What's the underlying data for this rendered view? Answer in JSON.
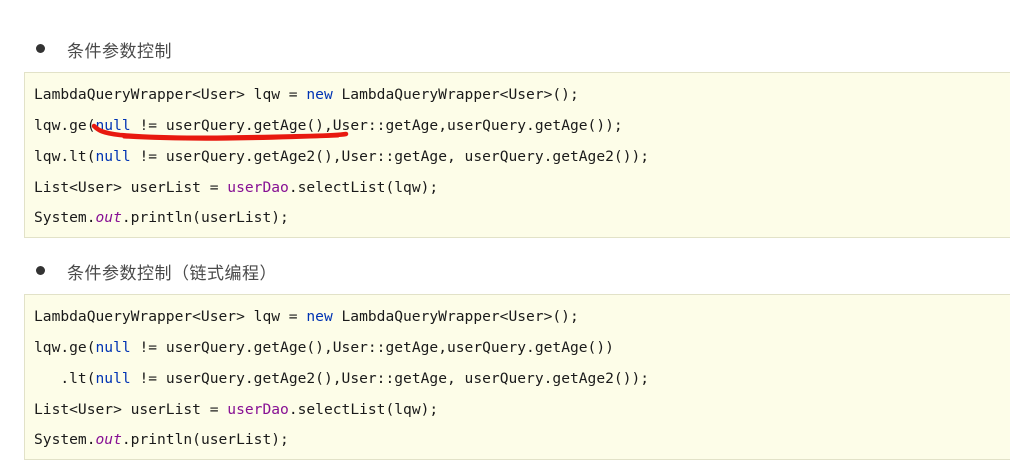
{
  "section1": {
    "heading": "条件参数控制",
    "lines": [
      [
        {
          "t": "LambdaQueryWrapper<User> lqw = ",
          "c": ""
        },
        {
          "t": "new",
          "c": "kw"
        },
        {
          "t": " LambdaQueryWrapper<User>();",
          "c": ""
        }
      ],
      [
        {
          "t": "lqw.ge(",
          "c": ""
        },
        {
          "t": "null",
          "c": "kw"
        },
        {
          "t": " != userQuery.getAge(),User::getAge,userQuery.getAge());",
          "c": ""
        }
      ],
      [
        {
          "t": "lqw.lt(",
          "c": ""
        },
        {
          "t": "null",
          "c": "kw"
        },
        {
          "t": " != userQuery.getAge2(),User::getAge, userQuery.getAge2());",
          "c": ""
        }
      ],
      [
        {
          "t": "List<User> userList = ",
          "c": ""
        },
        {
          "t": "userDao",
          "c": "var"
        },
        {
          "t": ".selectList(lqw);",
          "c": ""
        }
      ],
      [
        {
          "t": "System.",
          "c": ""
        },
        {
          "t": "out",
          "c": "it"
        },
        {
          "t": ".println(userList);",
          "c": ""
        }
      ]
    ]
  },
  "section2": {
    "heading": "条件参数控制（链式编程）",
    "lines": [
      [
        {
          "t": "LambdaQueryWrapper<User> lqw = ",
          "c": ""
        },
        {
          "t": "new",
          "c": "kw"
        },
        {
          "t": " LambdaQueryWrapper<User>();",
          "c": ""
        }
      ],
      [
        {
          "t": "lqw.ge(",
          "c": ""
        },
        {
          "t": "null",
          "c": "kw"
        },
        {
          "t": " != userQuery.getAge(),User::getAge,userQuery.getAge())",
          "c": ""
        }
      ],
      [
        {
          "t": "   .lt(",
          "c": ""
        },
        {
          "t": "null",
          "c": "kw"
        },
        {
          "t": " != userQuery.getAge2(),User::getAge, userQuery.getAge2());",
          "c": ""
        }
      ],
      [
        {
          "t": "List<User> userList = ",
          "c": ""
        },
        {
          "t": "userDao",
          "c": "var"
        },
        {
          "t": ".selectList(lqw);",
          "c": ""
        }
      ],
      [
        {
          "t": "System.",
          "c": ""
        },
        {
          "t": "out",
          "c": "it"
        },
        {
          "t": ".println(userList);",
          "c": ""
        }
      ]
    ]
  },
  "colors": {
    "keyword": "#0033b3",
    "field": "#871094",
    "annotation_underline": "#e8190f",
    "code_background": "#fdfde8"
  }
}
